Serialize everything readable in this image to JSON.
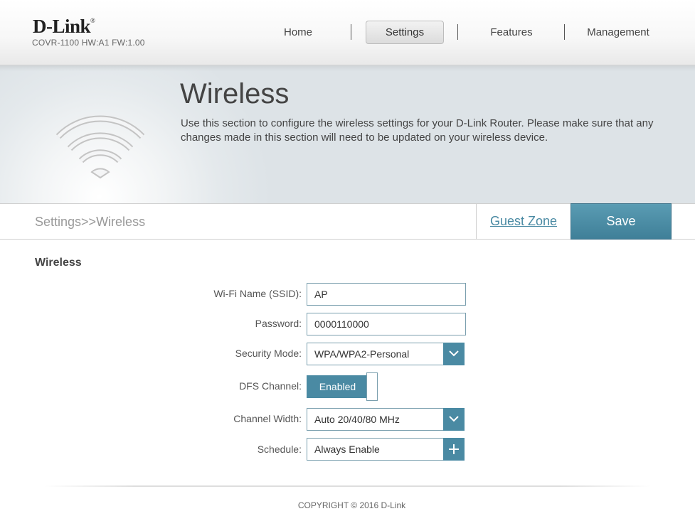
{
  "header": {
    "logo": "D-Link",
    "logo_mark": "®",
    "model": "COVR-1100 HW:A1 FW:1.00",
    "nav": {
      "home": "Home",
      "settings": "Settings",
      "features": "Features",
      "management": "Management"
    }
  },
  "hero": {
    "title": "Wireless",
    "description": "Use this section to configure the wireless settings for your D-Link Router. Please make sure that any changes made in this section will need to be updated on your wireless device.",
    "icon": "wifi-icon"
  },
  "subbar": {
    "breadcrumb": "Settings>>Wireless",
    "guest_zone": "Guest Zone",
    "save": "Save"
  },
  "form": {
    "section_title": "Wireless",
    "ssid": {
      "label": "Wi-Fi Name (SSID):",
      "value": "AP"
    },
    "password": {
      "label": "Password:",
      "value": "0000110000"
    },
    "security_mode": {
      "label": "Security Mode:",
      "value": "WPA/WPA2-Personal"
    },
    "dfs_channel": {
      "label": "DFS Channel:",
      "value": "Enabled"
    },
    "channel_width": {
      "label": "Channel Width:",
      "value": "Auto 20/40/80 MHz"
    },
    "schedule": {
      "label": "Schedule:",
      "value": "Always Enable"
    }
  },
  "footer": {
    "copyright": "COPYRIGHT © 2016 D-Link"
  },
  "colors": {
    "accent": "#4a8aa3",
    "link": "#4a8aa3",
    "text": "#444444"
  }
}
